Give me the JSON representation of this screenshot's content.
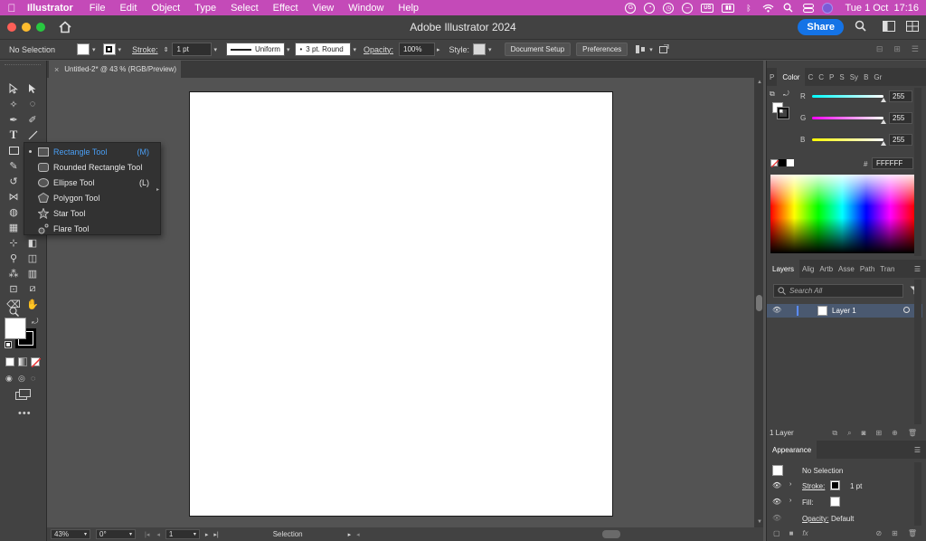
{
  "menubar": {
    "app_name": "Illustrator",
    "menus": [
      "File",
      "Edit",
      "Object",
      "Type",
      "Select",
      "Effect",
      "View",
      "Window",
      "Help"
    ],
    "status_icons": [
      "grammarly-icon",
      "creative-cloud-icon",
      "clock-icon",
      "do-not-disturb-icon",
      "language-icon",
      "battery-icon",
      "bluetooth-icon",
      "wifi-icon",
      "search-icon",
      "siri-icon"
    ],
    "input_source": "US",
    "datetime": "Tue 1 Oct  17:16"
  },
  "titlebar": {
    "title": "Adobe Illustrator 2024",
    "share_label": "Share"
  },
  "controlbar": {
    "selection": "No Selection",
    "stroke_label": "Stroke:",
    "stroke_weight": "1 pt",
    "profile": "Uniform",
    "brush": "3 pt. Round",
    "opacity_label": "Opacity:",
    "opacity": "100%",
    "style_label": "Style:",
    "document_setup": "Document Setup",
    "preferences": "Preferences"
  },
  "document_tab": {
    "name": "Untitled-2* @ 43 % (RGB/Preview)",
    "close": "×"
  },
  "flyout": {
    "items": [
      {
        "label": "Rectangle Tool",
        "key": "(M)",
        "active": true
      },
      {
        "label": "Rounded Rectangle Tool",
        "key": "",
        "active": false
      },
      {
        "label": "Ellipse Tool",
        "key": "(L)",
        "active": false
      },
      {
        "label": "Polygon Tool",
        "key": "",
        "active": false
      },
      {
        "label": "Star Tool",
        "key": "",
        "active": false
      },
      {
        "label": "Flare Tool",
        "key": "",
        "active": false
      }
    ]
  },
  "color_panel": {
    "tabs": [
      "P",
      "Color",
      "C",
      "C",
      "P",
      "S",
      "Sy",
      "B",
      "Gr"
    ],
    "channels": [
      {
        "name": "R",
        "value": "255",
        "color": "#ff3b3b"
      },
      {
        "name": "G",
        "value": "255",
        "color": "#3bd13b"
      },
      {
        "name": "B",
        "value": "255",
        "color": "#3b6bff"
      }
    ],
    "hex_symbol": "#",
    "hex": "FFFFFF"
  },
  "layers_panel": {
    "tabs": [
      "Layers",
      "Alig",
      "Artb",
      "Asse",
      "Path",
      "Tran"
    ],
    "search_placeholder": "Search All",
    "layer_name": "Layer 1",
    "layer_count": "1 Layer"
  },
  "appearance_panel": {
    "title": "Appearance",
    "selection": "No Selection",
    "stroke_label": "Stroke:",
    "stroke_value": "1 pt",
    "fill_label": "Fill:",
    "opacity_label": "Opacity:",
    "opacity_value": "Default"
  },
  "statusbar": {
    "zoom": "43%",
    "rotation": "0°",
    "artboard": "1",
    "tool": "Selection"
  }
}
